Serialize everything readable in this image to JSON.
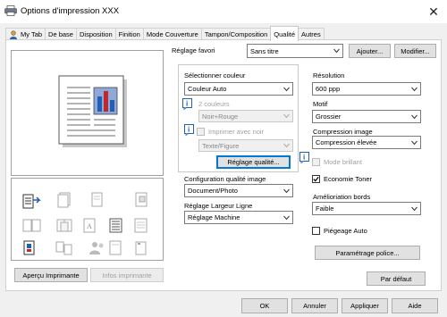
{
  "window": {
    "title": "Options d'impression XXX",
    "close_glyph": "✕"
  },
  "tabs": [
    {
      "label": "My Tab",
      "icon": "user-icon"
    },
    {
      "label": "De base"
    },
    {
      "label": "Disposition"
    },
    {
      "label": "Finition"
    },
    {
      "label": "Mode Couverture"
    },
    {
      "label": "Tampon/Composition"
    },
    {
      "label": "Qualité",
      "active": true
    },
    {
      "label": "Autres"
    }
  ],
  "favorite": {
    "label": "Réglage favori",
    "value": "Sans titre",
    "add_label": "Ajouter...",
    "modify_label": "Modifier..."
  },
  "left": {
    "select_color_label": "Sélectionner couleur",
    "select_color_value": "Couleur Auto",
    "two_colors_label": "2 couleurs",
    "two_colors_value": "Noir+Rouge",
    "print_black_label": "Imprimer avec noir",
    "print_black_value": "Texte/Figure",
    "quality_setting_button": "Réglage qualité...",
    "image_quality_config_label": "Configuration qualité image",
    "image_quality_config_value": "Document/Photo",
    "line_width_label": "Réglage Largeur Ligne",
    "line_width_value": "Réglage Machine"
  },
  "right": {
    "resolution_label": "Résolution",
    "resolution_value": "600 ppp",
    "pattern_label": "Motif",
    "pattern_value": "Grossier",
    "compression_label": "Compression image",
    "compression_value": "Compression élevée",
    "glossy_label": "Mode brillant",
    "toner_label": "Economie Toner",
    "toner_checked": true,
    "edge_label": "Amélioriation bords",
    "edge_value": "Faible",
    "trapping_label": "Piégeage Auto",
    "font_settings_button": "Paramétrage police..."
  },
  "preview": {
    "printer_view_button": "Aperçu Imprimante",
    "printer_info_button": "Infos imprimante"
  },
  "default_button": "Par défaut",
  "footer": {
    "ok": "OK",
    "cancel": "Annuler",
    "apply": "Appliquer",
    "help": "Aide"
  },
  "colors": {
    "accent": "#0078d7",
    "icon_blue": "#1f5fb4",
    "icon_red": "#c0282a"
  }
}
